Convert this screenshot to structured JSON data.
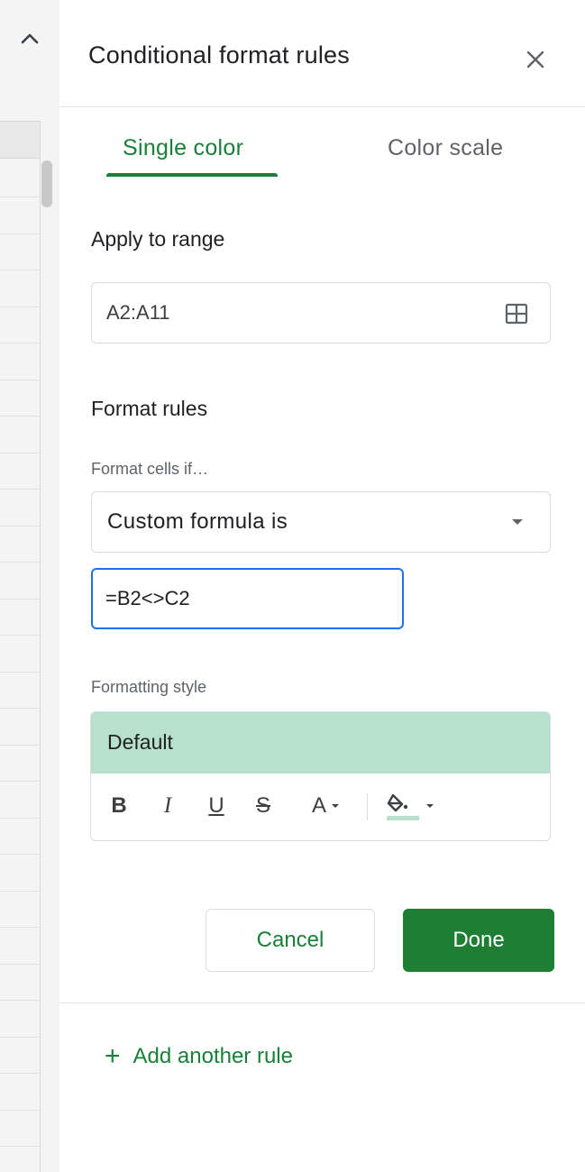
{
  "panel": {
    "title": "Conditional format rules",
    "close_icon": "close-icon",
    "collapse_icon": "chevron-up-icon"
  },
  "tabs": [
    {
      "label": "Single color",
      "active": true
    },
    {
      "label": "Color scale",
      "active": false
    }
  ],
  "apply_to_range": {
    "label": "Apply to range",
    "value": "A2:A11",
    "icon": "grid-select-icon"
  },
  "format_rules": {
    "label": "Format rules",
    "condition_label": "Format cells if…",
    "condition_value": "Custom formula is",
    "formula_value": "=B2<>C2"
  },
  "formatting_style": {
    "label": "Formatting style",
    "preview_text": "Default",
    "preview_color": "#b7e1cd",
    "toolbar": {
      "bold": "B",
      "italic": "I",
      "underline": "U",
      "strikethrough": "S",
      "text_color": "A"
    }
  },
  "actions": {
    "cancel": "Cancel",
    "done": "Done"
  },
  "add_rule": {
    "plus": "+",
    "label": "Add another rule"
  },
  "colors": {
    "accent_green": "#188038",
    "done_button": "#1e7e34",
    "focus_blue": "#1a73e8"
  }
}
